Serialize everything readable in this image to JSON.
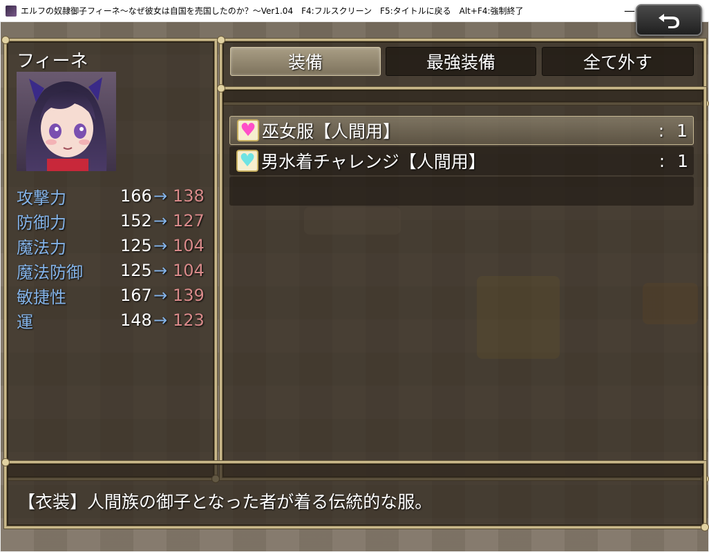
{
  "window": {
    "title": "エルフの奴隷御子フィーネ～なぜ彼女は自国を売国したのか？～Ver1.04　F4:フルスクリーン　F5:タイトルに戻る　Alt+F4:強制終了",
    "minimize_glyph": "—",
    "maximize_glyph": "☐",
    "close_glyph": "✕"
  },
  "actor": {
    "name": "フィーネ",
    "face_icon": "character-portrait"
  },
  "stats": [
    {
      "label": "攻撃力",
      "current": "166",
      "arrow": "→",
      "new": "138"
    },
    {
      "label": "防御力",
      "current": "152",
      "arrow": "→",
      "new": "127"
    },
    {
      "label": "魔法力",
      "current": "125",
      "arrow": "→",
      "new": "104"
    },
    {
      "label": "魔法防御",
      "current": "125",
      "arrow": "→",
      "new": "104"
    },
    {
      "label": "敏捷性",
      "current": "167",
      "arrow": "→",
      "new": "139"
    },
    {
      "label": "運",
      "current": "148",
      "arrow": "→",
      "new": "123"
    }
  ],
  "commands": [
    {
      "label": "装備",
      "selected": true
    },
    {
      "label": "最強装備",
      "selected": false
    },
    {
      "label": "全て外す",
      "selected": false
    }
  ],
  "items": [
    {
      "icon": "pink-heart-icon",
      "icon_color": "#ff4fc8",
      "name": "巫女服【人間用】",
      "sep": ":",
      "count": "1",
      "selected": true
    },
    {
      "icon": "cyan-heart-icon",
      "icon_color": "#6fe3e3",
      "name": "男水着チャレンジ【人間用】",
      "sep": ":",
      "count": "1",
      "selected": false
    }
  ],
  "help": {
    "text": "【衣装】人間族の御子となった者が着る伝統的な服。"
  },
  "colors": {
    "frame_gold": "#c9b88a",
    "stat_label_blue": "#84b3e8",
    "stat_decrease_red": "#d98a8a"
  }
}
